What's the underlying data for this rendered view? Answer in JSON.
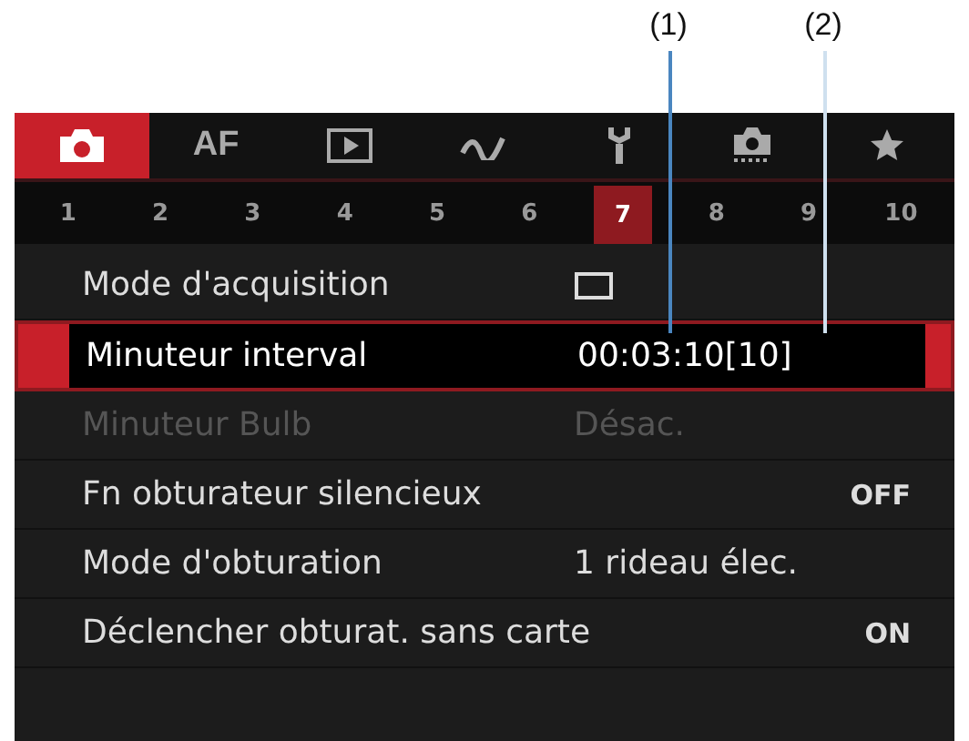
{
  "callouts": [
    {
      "label": "(1)"
    },
    {
      "label": "(2)"
    }
  ],
  "tabs": [
    {
      "kind": "camera",
      "selected": true
    },
    {
      "kind": "text",
      "label": "AF",
      "selected": false
    },
    {
      "kind": "play",
      "selected": false
    },
    {
      "kind": "wave",
      "selected": false
    },
    {
      "kind": "wrench",
      "selected": false
    },
    {
      "kind": "camera-dots",
      "selected": false
    },
    {
      "kind": "star",
      "selected": false
    }
  ],
  "pages": [
    {
      "label": "1",
      "selected": false
    },
    {
      "label": "2",
      "selected": false
    },
    {
      "label": "3",
      "selected": false
    },
    {
      "label": "4",
      "selected": false
    },
    {
      "label": "5",
      "selected": false
    },
    {
      "label": "6",
      "selected": false
    },
    {
      "label": "7",
      "selected": true
    },
    {
      "label": "8",
      "selected": false
    },
    {
      "label": "9",
      "selected": false
    },
    {
      "label": "10",
      "selected": false
    }
  ],
  "items": [
    {
      "label": "Mode d'acquisition",
      "kind": "icon",
      "selected": false,
      "disabled": false
    },
    {
      "label": "Minuteur interval",
      "value": "00:03:10[10]",
      "kind": "text",
      "selected": true,
      "disabled": false
    },
    {
      "label": "Minuteur Bulb",
      "value": "Désac.",
      "kind": "text",
      "selected": false,
      "disabled": true
    },
    {
      "label": "Fn obturateur silencieux",
      "value": "OFF",
      "kind": "flag",
      "selected": false,
      "disabled": false
    },
    {
      "label": "Mode d'obturation",
      "value": "1 rideau élec.",
      "kind": "text",
      "selected": false,
      "disabled": false
    },
    {
      "label": "Déclencher obturat. sans carte",
      "value": "ON",
      "kind": "flag",
      "selected": false,
      "disabled": false
    }
  ]
}
